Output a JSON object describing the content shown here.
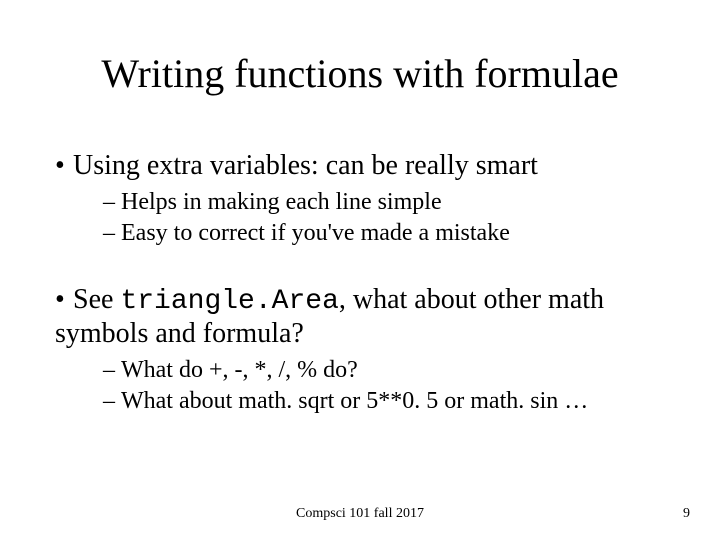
{
  "title": "Writing functions with formulae",
  "bullet1": {
    "text": "Using extra variables: can be really smart",
    "sub1": "Helps in making each line simple",
    "sub2": "Easy to correct if you've made a mistake"
  },
  "bullet2": {
    "prefix": "See ",
    "code": "triangle.Area",
    "suffix": ", what about other math symbols and formula?",
    "sub1": "What do +, -, *, /, % do?",
    "sub2": "What about math. sqrt or 5**0. 5 or math. sin …"
  },
  "footer": {
    "center": "Compsci 101 fall 2017",
    "page": "9"
  }
}
